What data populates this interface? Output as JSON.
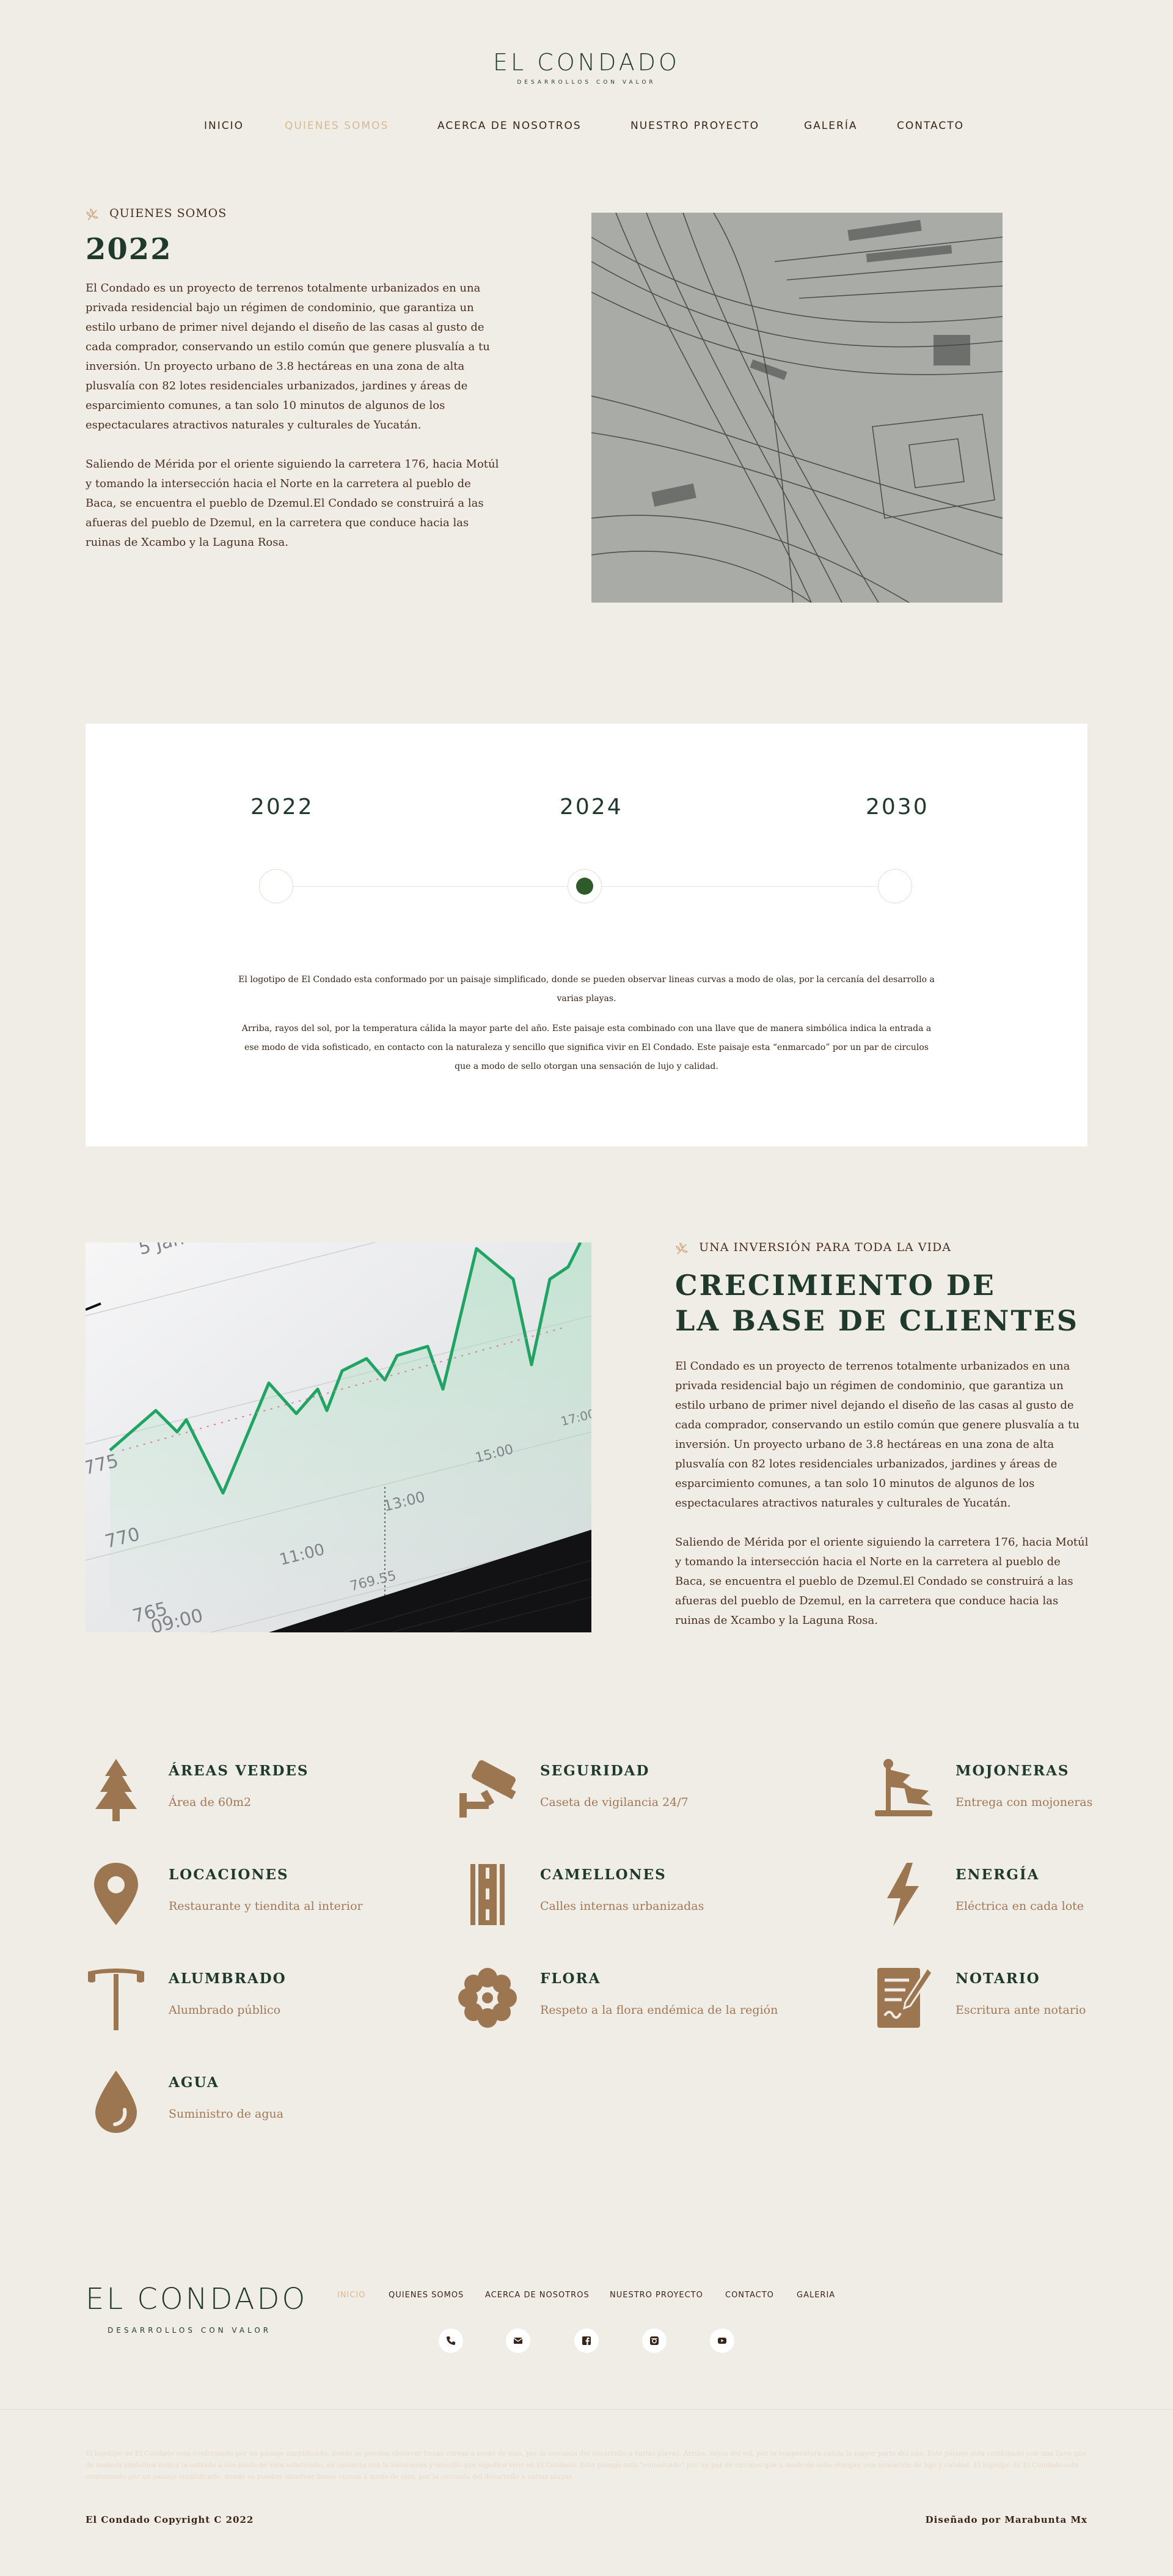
{
  "header": {
    "brand": "EL CONDADO",
    "tagline": "DESARROLLOS CON VALOR",
    "nav": [
      {
        "label": "INICIO",
        "active": false
      },
      {
        "label": "QUIENES SOMOS",
        "active": true
      },
      {
        "label": "ACERCA DE NOSOTROS",
        "active": false
      },
      {
        "label": "NUESTRO PROYECTO",
        "active": false
      },
      {
        "label": "GALERÍA",
        "active": false
      },
      {
        "label": "CONTACTO",
        "active": false
      }
    ]
  },
  "about": {
    "eyebrow": "QUIENES SOMOS",
    "title": "2022",
    "p1": "El Condado es un proyecto de terrenos totalmente urbanizados en una privada residencial bajo un régimen de condominio, que garantiza un estilo urbano de primer nivel dejando el diseño de las casas al gusto de cada comprador, conservando un estilo común que genere plusvalía a tu inversión. Un proyecto urbano de 3.8 hectáreas en una zona de alta plusvalía con 82 lotes residenciales urbanizados, jardines y áreas de esparcimiento comunes, a tan solo 10 minutos de algunos de los espectaculares atractivos naturales y culturales de Yucatán.",
    "p2": "Saliendo de Mérida por el oriente siguiendo la carretera 176, hacia Motúl y tomando la intersección hacia el Norte en la carretera al pueblo de Baca, se encuentra el pueblo de Dzemul.El Condado se construirá a las afueras del pueblo de Dzemul, en la carretera que conduce hacia las ruinas de Xcambo y la Laguna Rosa."
  },
  "timeline": {
    "years": [
      "2022",
      "2024",
      "2030"
    ],
    "active_index": 1,
    "p1": "El logotipo de El Condado esta conformado por un paisaje simplificado, donde se pueden observar lineas curvas a modo de olas, por la cercanía del desarrollo a varias playas.",
    "p2": "Arriba, rayos del sol, por la temperatura cálida la mayor parte del año. Este paisaje esta combinado con una llave que de manera simbólica indica la entrada a ese modo de vida sofisticado, en contacto con la naturaleza y sencillo que significa vivir en El Condado. Este paisaje esta “enmarcado” por un par de circulos que a modo de sello otorgan una sensación de lujo y calidad."
  },
  "growth": {
    "eyebrow": "UNA INVERSIÓN PARA TODA LA VIDA",
    "title_line1": "CRECIMIENTO DE",
    "title_line2": "LA BASE DE CLIENTES",
    "p1": "El Condado es un proyecto de terrenos totalmente urbanizados en una privada residencial bajo un régimen de condominio, que garantiza un estilo urbano de primer nivel dejando el diseño de las casas al gusto de cada comprador, conservando un estilo común que genere plusvalía a tu inversión. Un proyecto urbano de 3.8 hectáreas en una zona de alta plusvalía con 82 lotes residenciales urbanizados, jardines y áreas de esparcimiento comunes, a tan solo 10 minutos de algunos de los espectaculares atractivos naturales y culturales de Yucatán.",
    "p2": "Saliendo de Mérida por el oriente siguiendo la carretera 176, hacia Motúl y tomando la intersección hacia el Norte en la carretera al pueblo de Baca, se encuentra el pueblo de Dzemul.El Condado se construirá a las afueras del pueblo de Dzemul, en la carretera que conduce hacia las ruinas de Xcambo y la Laguna Rosa.",
    "photo_labels": [
      "5 Jan",
      "775",
      "770",
      "765",
      "11:00",
      "13:00",
      "15:00",
      "17:00",
      "09:00",
      "769.55"
    ]
  },
  "amenities": [
    {
      "title": "ÁREAS VERDES",
      "subtitle": "Área de 60m2",
      "icon": "tree-icon"
    },
    {
      "title": "SEGURIDAD",
      "subtitle": "Caseta de vigilancia 24/7",
      "icon": "security-camera-icon"
    },
    {
      "title": "MOJONERAS",
      "subtitle": "Entrega con mojoneras",
      "icon": "flag-marker-icon"
    },
    {
      "title": "LOCACIONES",
      "subtitle": "Restaurante y tiendita al interior",
      "icon": "location-pin-icon"
    },
    {
      "title": "CAMELLONES",
      "subtitle": "Calles internas urbanizadas",
      "icon": "road-icon"
    },
    {
      "title": "ENERGÍA",
      "subtitle": "Eléctrica en cada lote",
      "icon": "lightning-icon"
    },
    {
      "title": "ALUMBRADO",
      "subtitle": "Alumbrado público",
      "icon": "street-lamp-icon"
    },
    {
      "title": "FLORA",
      "subtitle": "Respeto a la flora endémica de la región",
      "icon": "flower-icon"
    },
    {
      "title": "NOTARIO",
      "subtitle": "Escritura ante notario",
      "icon": "document-signature-icon"
    },
    {
      "title": "AGUA",
      "subtitle": "Suministro de agua",
      "icon": "water-drop-icon"
    }
  ],
  "footer": {
    "brand": "EL CONDADO",
    "tagline": "DESARROLLOS CON VALOR",
    "nav": [
      {
        "label": "INICIO",
        "active": true
      },
      {
        "label": "QUIENES SOMOS",
        "active": false
      },
      {
        "label": "ACERCA DE NOSOTROS",
        "active": false
      },
      {
        "label": "NUESTRO PROYECTO",
        "active": false
      },
      {
        "label": "CONTACTO",
        "active": false
      },
      {
        "label": "GALERIA",
        "active": false
      }
    ],
    "social": [
      "phone-icon",
      "email-icon",
      "facebook-icon",
      "instagram-icon",
      "youtube-icon"
    ],
    "legal": "El logotipo de El Condado esta conformado por un paisaje simplificado, donde se pueden observar lineas curvas a modo de olas, por la cercanía del desarrollo a varias playas. Arriba, rayos del sol, por la temperatura cálida la mayor parte del año. Este paisaje esta combinado con una llave que de manera simbólica indica la entrada a ese modo de vida sofisticado, en contacto con la naturaleza y sencillo que significa vivir en El Condado. Este paisaje esta “enmarcado” por un par de circulos que a modo de sello otorgan una sensación de lujo y calidad. El logotipo de El Condado esta conformado por un paisaje simplificado, donde se pueden observar lineas curvas a modo de olas, por la cercanía del desarrollo a varias playas.",
    "copyright": "El Condado Copyright C 2022",
    "credit": "Diseñado por Marabunta Mx"
  },
  "colors": {
    "background": "#f0ede7",
    "brand_green": "#1f3a2c",
    "accent_brown": "#a17855",
    "active_tan": "#d9b892",
    "dot_green": "#2f5a2a"
  }
}
